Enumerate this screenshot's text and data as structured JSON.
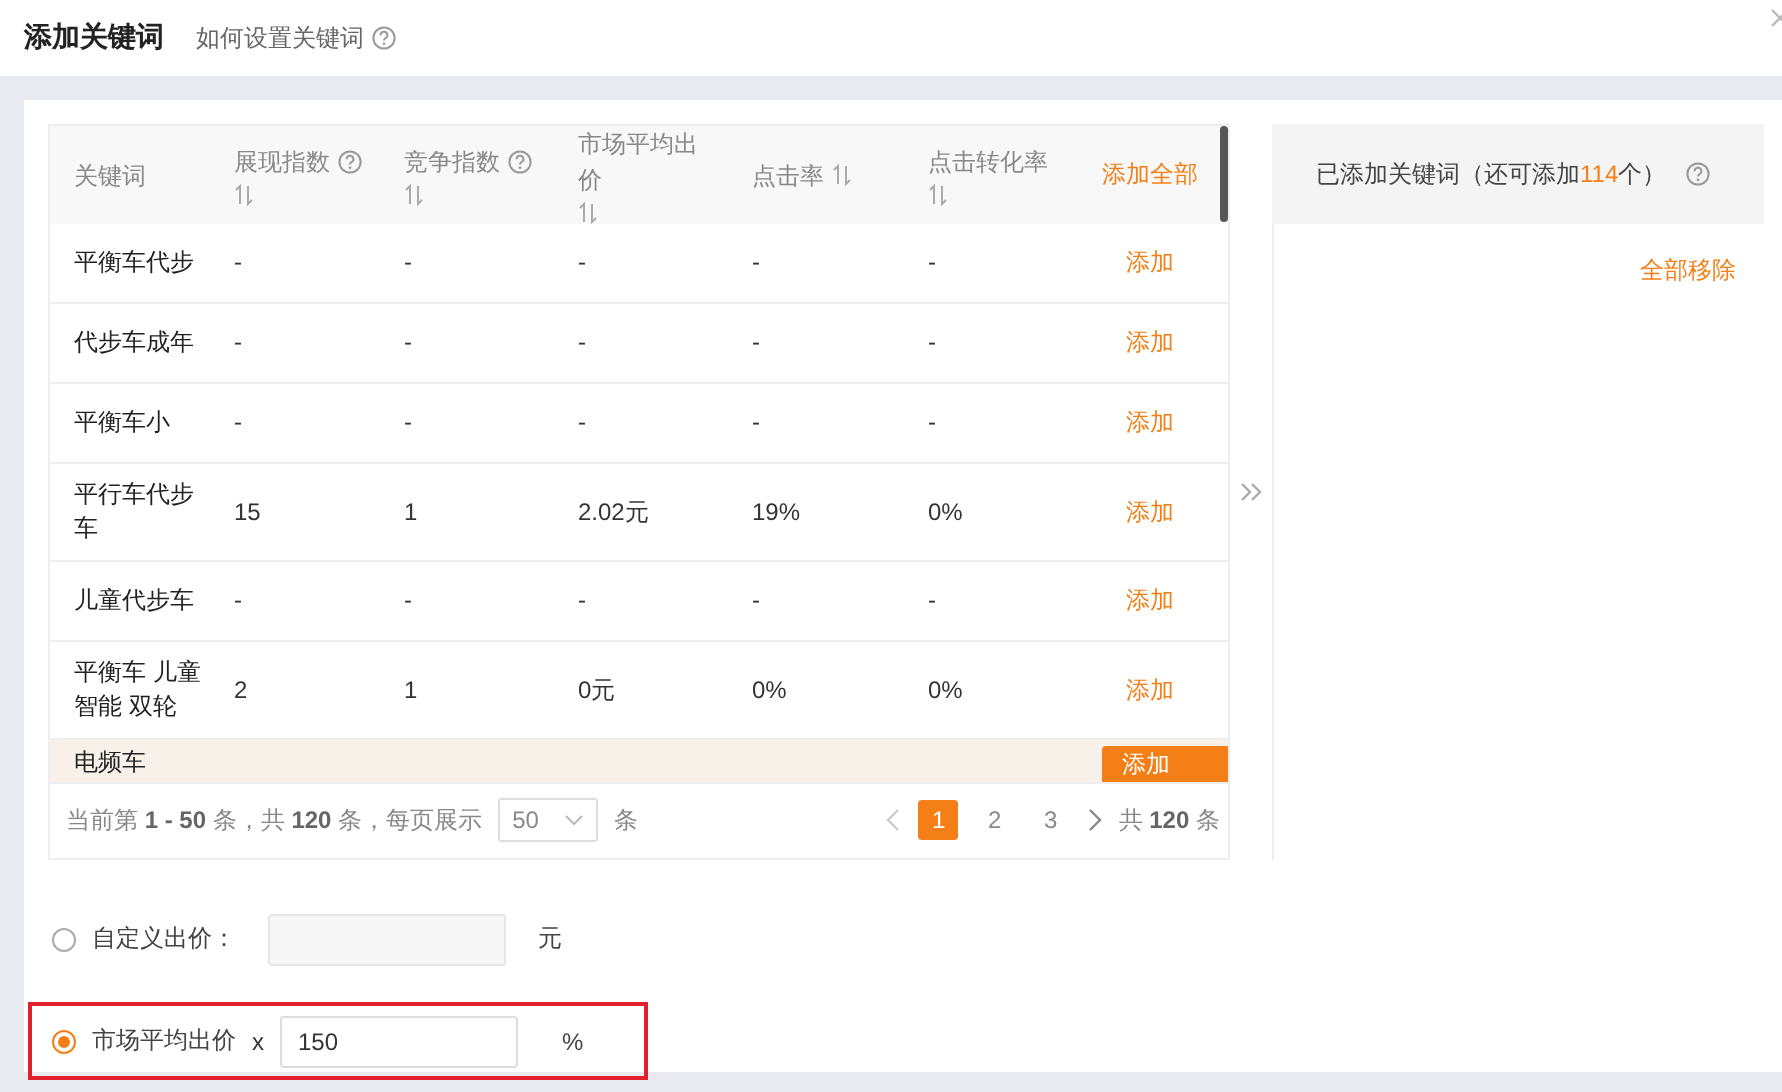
{
  "dialog": {
    "title": "添加关键词",
    "help_link": "如何设置关键词"
  },
  "keyword_table": {
    "columns": [
      {
        "label": "关键词",
        "help": false,
        "sortable": false
      },
      {
        "label": "展现指数",
        "help": true,
        "sortable": true
      },
      {
        "label": "竞争指数",
        "help": true,
        "sortable": true
      },
      {
        "label": "市场平均出价",
        "help": false,
        "sortable": true
      },
      {
        "label": "点击率",
        "help": false,
        "sortable": true
      },
      {
        "label": "点击转化率",
        "help": false,
        "sortable": true
      }
    ],
    "add_all": "添加全部",
    "rows": [
      {
        "keyword": "平衡车代步",
        "impressions": "-",
        "competition": "-",
        "avg_bid": "-",
        "ctr": "-",
        "cvr": "-",
        "action": "添加",
        "hovered": false
      },
      {
        "keyword": "代步车成年",
        "impressions": "-",
        "competition": "-",
        "avg_bid": "-",
        "ctr": "-",
        "cvr": "-",
        "action": "添加",
        "hovered": false
      },
      {
        "keyword": "平衡车小",
        "impressions": "-",
        "competition": "-",
        "avg_bid": "-",
        "ctr": "-",
        "cvr": "-",
        "action": "添加",
        "hovered": false
      },
      {
        "keyword": "平行车代步车",
        "impressions": "15",
        "competition": "1",
        "avg_bid": "2.02元",
        "ctr": "19%",
        "cvr": "0%",
        "action": "添加",
        "hovered": false
      },
      {
        "keyword": "儿童代步车",
        "impressions": "-",
        "competition": "-",
        "avg_bid": "-",
        "ctr": "-",
        "cvr": "-",
        "action": "添加",
        "hovered": false
      },
      {
        "keyword": "平衡车 儿童智能 双轮",
        "impressions": "2",
        "competition": "1",
        "avg_bid": "0元",
        "ctr": "0%",
        "cvr": "0%",
        "action": "添加",
        "hovered": false
      },
      {
        "keyword": "电频车",
        "action": "添加",
        "hovered": true
      }
    ]
  },
  "pagination": {
    "summary": "当前第 **1 - 50** 条，共 **120** 条，每页展示",
    "page_size": "50",
    "unit": "条",
    "pages": [
      {
        "label": "1",
        "selected": true
      },
      {
        "label": "2",
        "selected": false
      },
      {
        "label": "3",
        "selected": false
      }
    ],
    "total": "共 **120** 条"
  },
  "added_panel": {
    "title_prefix": "已添加关键词（还可添加",
    "count": "114",
    "title_suffix": "个）",
    "remove_all": "全部移除"
  },
  "bid_options": [
    {
      "kind": "fixed",
      "label": "自定义出价：",
      "selected": false,
      "highlighted": false,
      "unit": "元"
    },
    {
      "kind": "multiplier",
      "label": "市场平均出价",
      "selected": true,
      "highlighted": true,
      "operator": "x",
      "value": "150",
      "unit": "%"
    }
  ]
}
